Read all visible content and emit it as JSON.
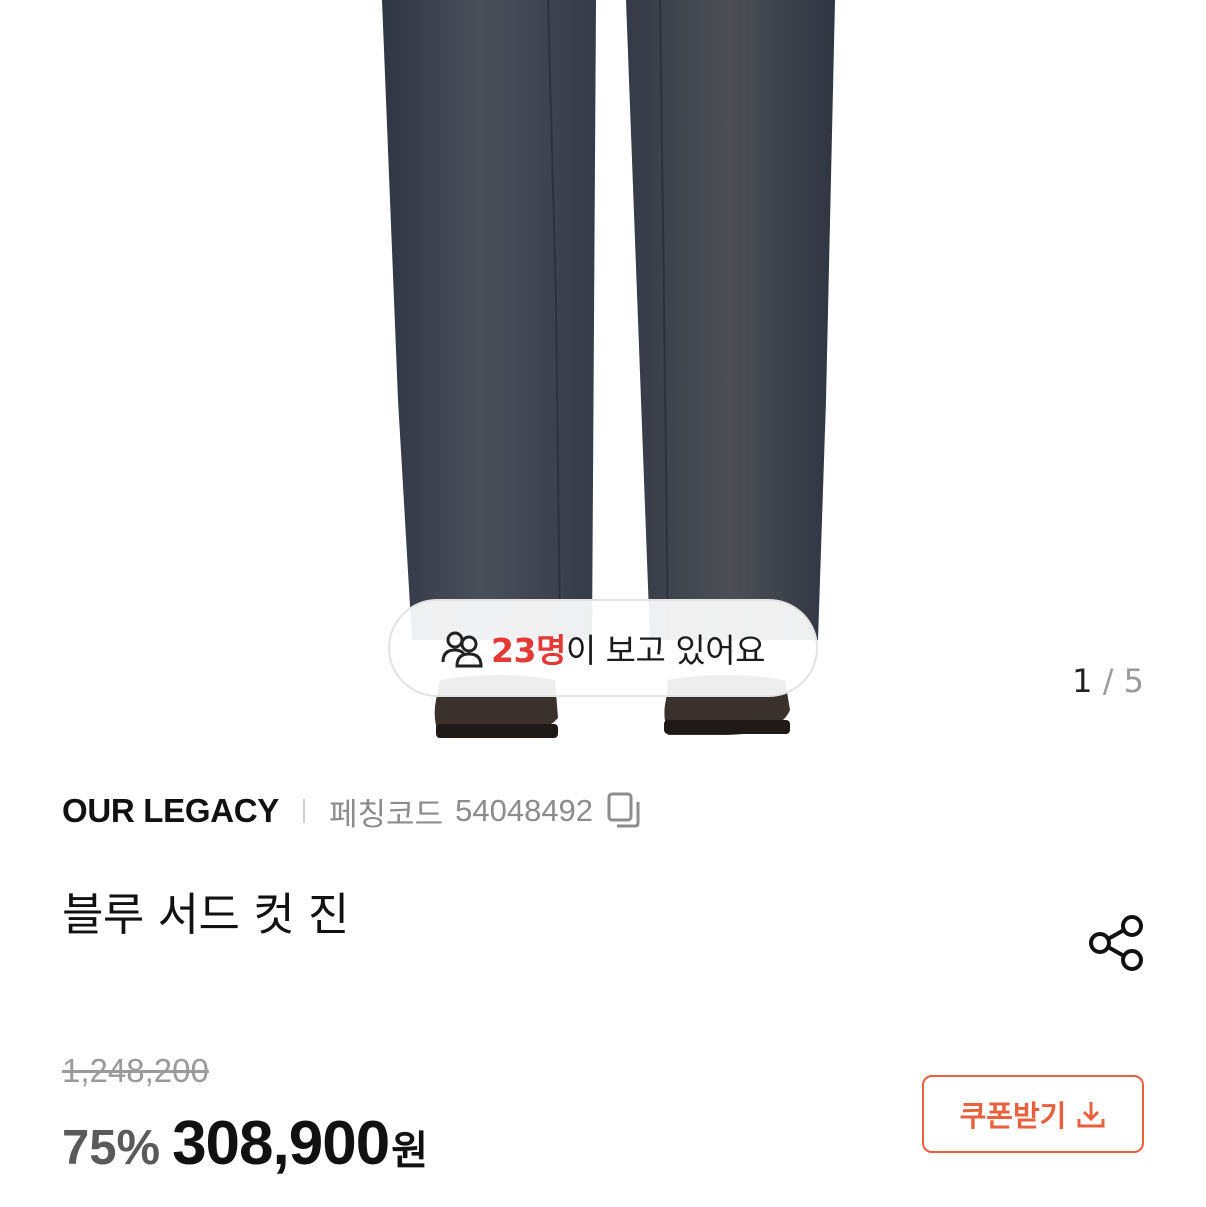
{
  "gallery": {
    "viewers_count": "23명",
    "viewers_suffix": "이 보고 있어요",
    "counter_current": "1",
    "counter_separator": "/",
    "counter_total": "5"
  },
  "product": {
    "brand": "OUR LEGACY",
    "code_label": "페칭코드",
    "code_value": "54048492",
    "title": "블루 서드 컷 진"
  },
  "price": {
    "original": "1,248,200",
    "discount_rate": "75%",
    "sale_price": "308,900",
    "unit": "원"
  },
  "coupon": {
    "label": "쿠폰받기"
  },
  "colors": {
    "accent_red": "#e53935",
    "coupon_orange": "#e8603c",
    "denim": "#3b4352"
  },
  "icons": [
    "people-icon",
    "copy-icon",
    "share-icon",
    "download-icon"
  ]
}
